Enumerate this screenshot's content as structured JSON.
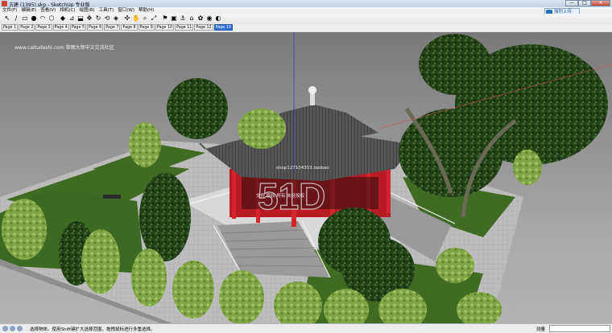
{
  "window": {
    "title": "古建 (1395).skp - SketchUp 专业版",
    "controls": {
      "minimize": "—",
      "maximize": "□",
      "close": "✕"
    }
  },
  "menu": {
    "items": [
      "文件(F)",
      "编辑(E)",
      "查看(V)",
      "相机(C)",
      "绘图(R)",
      "工具(T)",
      "窗口(W)",
      "帮助(H)"
    ]
  },
  "login_button": {
    "label": "强烈上传"
  },
  "toolbar": {
    "tools": [
      {
        "name": "select-tool-icon",
        "glyph": "↖"
      },
      {
        "name": "line-tool-icon",
        "glyph": "∕"
      },
      {
        "name": "rectangle-tool-icon",
        "glyph": "▭"
      },
      {
        "name": "circle-tool-icon",
        "glyph": "●"
      },
      {
        "name": "arc-tool-icon",
        "glyph": "◠"
      },
      {
        "name": "polygon-tool-icon",
        "glyph": "⬡"
      },
      {
        "name": "eraser-tool-icon",
        "glyph": "◆"
      },
      {
        "name": "tape-measure-icon",
        "glyph": "⊿"
      },
      {
        "name": "push-pull-icon",
        "glyph": "⬓"
      },
      {
        "name": "move-tool-icon",
        "glyph": "✥"
      },
      {
        "name": "rotate-tool-icon",
        "glyph": "↻"
      },
      {
        "name": "follow-me-icon",
        "glyph": "⟲"
      },
      {
        "name": "offset-tool-icon",
        "glyph": "◈"
      },
      {
        "name": "orbit-tool-icon",
        "glyph": "✣"
      },
      {
        "name": "pan-tool-icon",
        "glyph": "✋"
      },
      {
        "name": "zoom-tool-icon",
        "glyph": "⌕"
      },
      {
        "name": "zoom-extents-icon",
        "glyph": "⤢"
      },
      {
        "name": "add-location-icon",
        "glyph": "⚑"
      },
      {
        "name": "get-models-icon",
        "glyph": "▣"
      },
      {
        "name": "components-icon",
        "glyph": "⚓"
      },
      {
        "name": "warehouse-icon",
        "glyph": "⌂"
      },
      {
        "name": "materials-icon",
        "glyph": "✿"
      },
      {
        "name": "paint-bucket-icon",
        "glyph": "◉"
      },
      {
        "name": "styles-icon",
        "glyph": "◐"
      }
    ]
  },
  "pages": {
    "tabs": [
      "Page 1",
      "Page 2",
      "Page 3",
      "Page 4",
      "Page 5",
      "Page 6",
      "Page 7",
      "Page 8",
      "Page 9",
      "Page 10",
      "Page 11",
      "Page 12",
      "Page 13"
    ],
    "active_index": 12
  },
  "viewport": {
    "watermark": "www.caitudashi.com 草图大师中文交流社区",
    "center_watermark": "51D",
    "center_small_1": "shop127104353.taobao",
    "center_small_2": "文件  版权  所有  未经授权",
    "colors": {
      "ground": "#a2a2a2",
      "lawn": "#3f6b23",
      "paving": "#c2c2c2",
      "roof": "#4a4a4a",
      "column": "#c41f2a",
      "tree_dark": "#1f3a14",
      "tree_light": "#8ab04a"
    }
  },
  "status": {
    "message": "选择物体。使用Shift键扩大选择范围，拖拽鼠标进行多重选择。",
    "measure_label": "测量",
    "measure_value": ""
  }
}
